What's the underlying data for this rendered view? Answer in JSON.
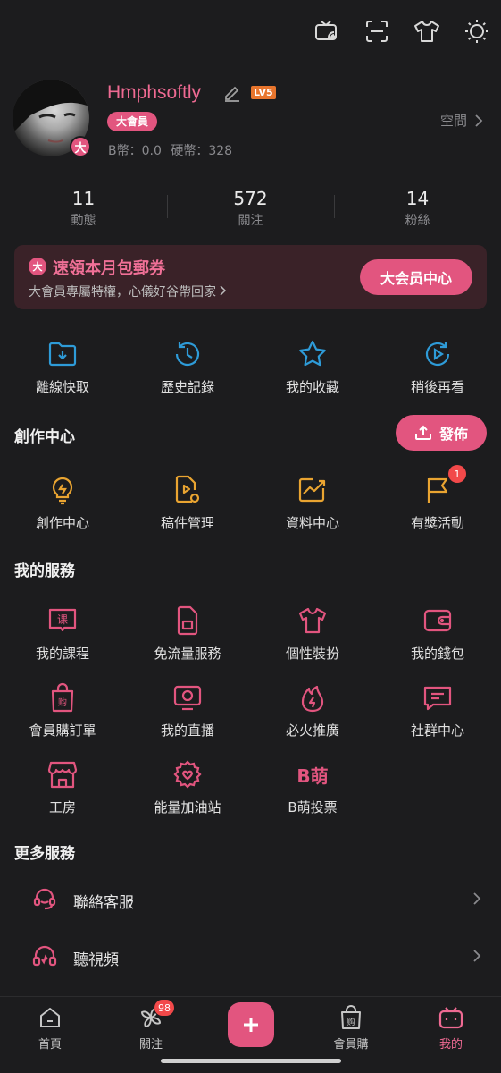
{
  "header": {
    "icons": [
      "tv-cast-icon",
      "scan-icon",
      "tshirt-icon",
      "sun-icon"
    ]
  },
  "profile": {
    "username": "Hmphsoftly",
    "level": "LV5",
    "vip_label": "大會員",
    "avatar_badge": "大",
    "coins": "B幣：0.0   硬幣：328",
    "space_label": "空間"
  },
  "stats": [
    {
      "num": "11",
      "label": "動態"
    },
    {
      "num": "572",
      "label": "關注"
    },
    {
      "num": "14",
      "label": "粉絲"
    }
  ],
  "vip_banner": {
    "icon": "大",
    "title": "速領本月包郵券",
    "subtitle": "大會員專屬特權，心儀好谷帶回家",
    "button": "大会员中心"
  },
  "quick": [
    {
      "label": "離線快取",
      "icon": "download-folder-icon"
    },
    {
      "label": "歷史記錄",
      "icon": "history-icon"
    },
    {
      "label": "我的收藏",
      "icon": "star-icon"
    },
    {
      "label": "稍後再看",
      "icon": "watch-later-icon"
    }
  ],
  "creator": {
    "title": "創作中心",
    "publish_label": "發佈",
    "items": [
      {
        "label": "創作中心",
        "icon": "lightbulb-icon"
      },
      {
        "label": "稿件管理",
        "icon": "manuscript-icon"
      },
      {
        "label": "資料中心",
        "icon": "chart-icon"
      },
      {
        "label": "有獎活動",
        "icon": "flag-icon",
        "badge": "1"
      }
    ]
  },
  "services": {
    "title": "我的服務",
    "items": [
      {
        "label": "我的課程",
        "icon": "course-icon"
      },
      {
        "label": "免流量服務",
        "icon": "sim-card-icon"
      },
      {
        "label": "個性裝扮",
        "icon": "tshirt-icon"
      },
      {
        "label": "我的錢包",
        "icon": "wallet-icon"
      },
      {
        "label": "會員購訂單",
        "icon": "shopping-bag-icon"
      },
      {
        "label": "我的直播",
        "icon": "live-tv-icon"
      },
      {
        "label": "必火推廣",
        "icon": "fire-icon"
      },
      {
        "label": "社群中心",
        "icon": "chat-icon"
      },
      {
        "label": "工房",
        "icon": "shop-icon"
      },
      {
        "label": "能量加油站",
        "icon": "energy-icon"
      },
      {
        "label": "B萌投票",
        "icon": "bmeng-icon",
        "icon_text": "B萌"
      }
    ]
  },
  "more": {
    "title": "更多服務",
    "items": [
      {
        "label": "聯絡客服",
        "icon": "headset-icon"
      },
      {
        "label": "聽視頻",
        "icon": "headphones-icon"
      }
    ]
  },
  "bottom_nav": [
    {
      "label": "首頁",
      "icon": "home-icon"
    },
    {
      "label": "關注",
      "icon": "pinwheel-icon",
      "badge": "98"
    },
    {
      "label": "會員購",
      "icon": "shopping-bag-icon"
    },
    {
      "label": "我的",
      "icon": "tv-mascot-icon",
      "active": true
    }
  ],
  "colors": {
    "accent": "#e2557f",
    "bg": "#1c1c1e",
    "yellow": "#e9a431",
    "blue": "#2e9bd8"
  }
}
